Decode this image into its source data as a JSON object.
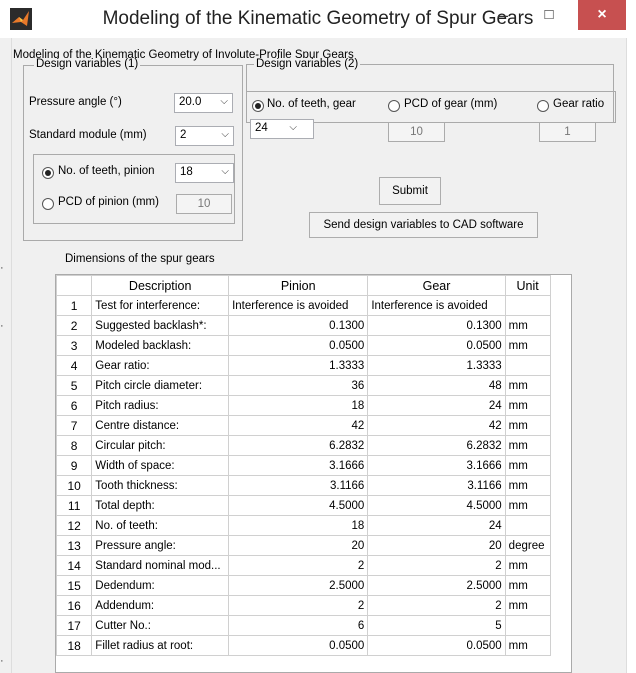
{
  "window": {
    "title": "Modeling of the Kinematic Geometry of Spur Gears",
    "minimize": "–",
    "maximize": "□",
    "close": "×"
  },
  "heading": "Modeling of the Kinematic Geometry of Involute-Profile Spur Gears",
  "group1": {
    "legend": "Design variables (1)",
    "pressure_label": "Pressure angle (°)",
    "pressure_value": "20.0",
    "module_label": "Standard module (mm)",
    "module_value": "2",
    "teeth_pinion_label": "No. of teeth, pinion",
    "teeth_pinion_value": "18",
    "pcd_pinion_label": "PCD of pinion (mm)",
    "pcd_pinion_value": "10"
  },
  "group2": {
    "legend": "Design variables (2)",
    "teeth_gear_label": "No. of teeth, gear",
    "teeth_gear_value": "24",
    "pcd_gear_label": "PCD of gear (mm)",
    "pcd_gear_value": "10",
    "ratio_label": "Gear ratio",
    "ratio_value": "1"
  },
  "submit_label": "Submit",
  "send_label": "Send design variables to CAD software",
  "table_title": "Dimensions of the spur gears",
  "table": {
    "headers": [
      "Description",
      "Pinion",
      "Gear",
      "Unit"
    ],
    "rows": [
      [
        "1",
        "Test for interference:",
        "Interference is avoided",
        "Interference is avoided",
        ""
      ],
      [
        "2",
        "Suggested backlash*:",
        "0.1300",
        "0.1300",
        "mm"
      ],
      [
        "3",
        "Modeled backlash:",
        "0.0500",
        "0.0500",
        "mm"
      ],
      [
        "4",
        "Gear ratio:",
        "1.3333",
        "1.3333",
        ""
      ],
      [
        "5",
        "Pitch circle diameter:",
        "36",
        "48",
        "mm"
      ],
      [
        "6",
        "Pitch radius:",
        "18",
        "24",
        "mm"
      ],
      [
        "7",
        "Centre distance:",
        "42",
        "42",
        "mm"
      ],
      [
        "8",
        "Circular pitch:",
        "6.2832",
        "6.2832",
        "mm"
      ],
      [
        "9",
        "Width of space:",
        "3.1666",
        "3.1666",
        "mm"
      ],
      [
        "10",
        "Tooth thickness:",
        "3.1166",
        "3.1166",
        "mm"
      ],
      [
        "11",
        "Total depth:",
        "4.5000",
        "4.5000",
        "mm"
      ],
      [
        "12",
        "No. of teeth:",
        "18",
        "24",
        ""
      ],
      [
        "13",
        "Pressure angle:",
        "20",
        "20",
        "degree"
      ],
      [
        "14",
        "Standard nominal mod...",
        "2",
        "2",
        "mm"
      ],
      [
        "15",
        "Dedendum:",
        "2.5000",
        "2.5000",
        "mm"
      ],
      [
        "16",
        "Addendum:",
        "2",
        "2",
        "mm"
      ],
      [
        "17",
        "Cutter No.:",
        "6",
        "5",
        ""
      ],
      [
        "18",
        "Fillet radius at root:",
        "0.0500",
        "0.0500",
        "mm"
      ]
    ]
  }
}
